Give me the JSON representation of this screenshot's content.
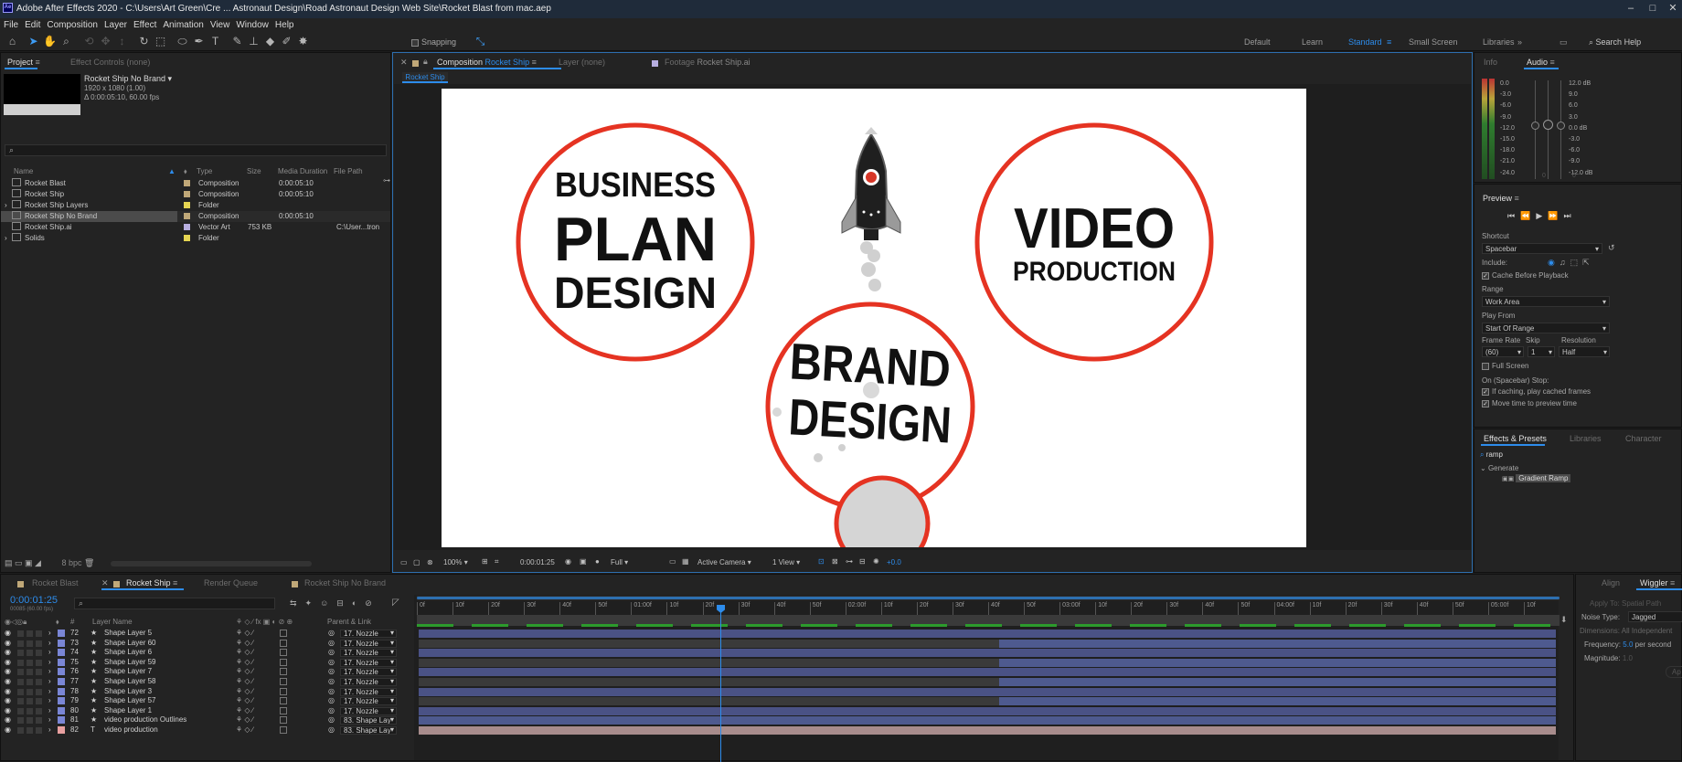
{
  "app": {
    "title": "Adobe After Effects 2020 - C:\\Users\\Art Green\\Cre ... Astronaut Design\\Road Astronaut Design Web Site\\Rocket Blast from mac.aep",
    "logo": "Ae"
  },
  "menu": [
    "File",
    "Edit",
    "Composition",
    "Layer",
    "Effect",
    "Animation",
    "View",
    "Window",
    "Help"
  ],
  "toolbar": {
    "snapping": "Snapping",
    "workspaces": [
      "Default",
      "Learn",
      "Standard",
      "Small Screen",
      "Libraries"
    ],
    "active_workspace": "Standard",
    "search": "Search Help"
  },
  "project": {
    "tab": "Project",
    "effect_controls": "Effect Controls (none)",
    "item_name": "Rocket Ship No Brand ▾",
    "item_dims": "1920 x 1080 (1.00)",
    "item_dur": "Δ 0:00:05:10, 60.00 fps",
    "columns": [
      "Name",
      "Type",
      "Size",
      "Media Duration",
      "File Path"
    ],
    "items": [
      {
        "name": "Rocket Blast",
        "type": "Composition",
        "size": "",
        "dur": "0:00:05:10",
        "path": "",
        "color": "#c0a878"
      },
      {
        "name": "Rocket Ship",
        "type": "Composition",
        "size": "",
        "dur": "0:00:05:10",
        "path": "",
        "color": "#c0a878"
      },
      {
        "name": "Rocket Ship Layers",
        "type": "Folder",
        "size": "",
        "dur": "",
        "path": "",
        "color": "#e6d552"
      },
      {
        "name": "Rocket Ship No Brand",
        "type": "Composition",
        "size": "",
        "dur": "0:00:05:10",
        "path": "",
        "color": "#c0a878"
      },
      {
        "name": "Rocket Ship.ai",
        "type": "Vector Art",
        "size": "753 KB",
        "dur": "",
        "path": "C:\\User...tron",
        "color": "#b7aee0"
      },
      {
        "name": "Solids",
        "type": "Folder",
        "size": "",
        "dur": "",
        "path": "",
        "color": "#e6d552"
      }
    ],
    "bpc": "8 bpc"
  },
  "viewer": {
    "tab_comp": "Composition",
    "comp_name": "Rocket Ship",
    "layer_tab": "Layer (none)",
    "footage_tab": "Footage",
    "footage_name": "Rocket Ship.ai",
    "breadcrumb": "Rocket Ship",
    "zoom": "100%",
    "timecode": "0:00:01:25",
    "resolution": "Full",
    "camera": "Active Camera",
    "views": "1 View",
    "exposure": "+0.0"
  },
  "artwork": {
    "circle1": [
      "BUSINESS",
      "PLAN",
      "DESIGN"
    ],
    "circle2": [
      "VIDEO",
      "PRODUCTION"
    ],
    "circle3": [
      "BRAND",
      "DESIGN"
    ],
    "ring_color": "#e53322"
  },
  "info": {
    "tab_info": "Info",
    "tab_audio": "Audio",
    "left_scale": [
      "0.0",
      "-3.0",
      "-6.0",
      "-9.0",
      "-12.0",
      "-15.0",
      "-18.0",
      "-21.0",
      "-24.0"
    ],
    "right_scale": [
      "12.0 dB",
      "9.0",
      "6.0",
      "3.0",
      "0.0 dB",
      "-3.0",
      "-6.0",
      "-9.0",
      "-12.0 dB"
    ],
    "meter_zero": [
      "0",
      "0"
    ]
  },
  "preview": {
    "title": "Preview",
    "shortcut_label": "Shortcut",
    "shortcut": "Spacebar",
    "include": "Include:",
    "cache": "Cache Before Playback",
    "range_label": "Range",
    "range": "Work Area",
    "play_from_label": "Play From",
    "play_from": "Start Of Range",
    "frame_rate_label": "Frame Rate",
    "skip_label": "Skip",
    "res_label": "Resolution",
    "frame_rate": "(60)",
    "skip": "1",
    "res": "Half",
    "full_screen": "Full Screen",
    "stop_label": "On (Spacebar) Stop:",
    "if_caching": "If caching, play cached frames",
    "move_time": "Move time to preview time"
  },
  "effects": {
    "tab": "Effects & Presets",
    "libraries": "Libraries",
    "character": "Character",
    "search": "ramp",
    "group": "Generate",
    "item": "Gradient Ramp"
  },
  "timeline": {
    "tabs": [
      "Rocket Blast",
      "Rocket Ship",
      "Render Queue",
      "Rocket Ship No Brand"
    ],
    "active_tab": "Rocket Ship",
    "timecode": "0:00:01:25",
    "frames": "00085 (60.00 fps)",
    "col_layer": "Layer Name",
    "col_num": "#",
    "col_parent": "Parent & Link",
    "ruler": [
      "0f",
      "10f",
      "20f",
      "30f",
      "40f",
      "50f",
      "01:00f",
      "10f",
      "20f",
      "30f",
      "40f",
      "50f",
      "02:00f",
      "10f",
      "20f",
      "30f",
      "40f",
      "50f",
      "03:00f",
      "10f",
      "20f",
      "30f",
      "40f",
      "50f",
      "04:00f",
      "10f",
      "20f",
      "30f",
      "40f",
      "50f",
      "05:00f",
      "10f"
    ],
    "playhead_frames": 85,
    "total_frames": 320,
    "layers": [
      {
        "num": "72",
        "name": "Shape Layer 5",
        "parent": "17. Nozzle",
        "type": "star",
        "color": "#7a86d6",
        "split": 0
      },
      {
        "num": "73",
        "name": "Shape Layer 60",
        "parent": "17. Nozzle",
        "type": "star",
        "color": "#7a86d6",
        "split": 163
      },
      {
        "num": "74",
        "name": "Shape Layer 6",
        "parent": "17. Nozzle",
        "type": "star",
        "color": "#7a86d6",
        "split": 0
      },
      {
        "num": "75",
        "name": "Shape Layer 59",
        "parent": "17. Nozzle",
        "type": "star",
        "color": "#7a86d6",
        "split": 163
      },
      {
        "num": "76",
        "name": "Shape Layer 7",
        "parent": "17. Nozzle",
        "type": "star",
        "color": "#7a86d6",
        "split": 0
      },
      {
        "num": "77",
        "name": "Shape Layer 58",
        "parent": "17. Nozzle",
        "type": "star",
        "color": "#7a86d6",
        "split": 163
      },
      {
        "num": "78",
        "name": "Shape Layer 3",
        "parent": "17. Nozzle",
        "type": "star",
        "color": "#7a86d6",
        "split": 0
      },
      {
        "num": "79",
        "name": "Shape Layer 57",
        "parent": "17. Nozzle",
        "type": "star",
        "color": "#7a86d6",
        "split": 163
      },
      {
        "num": "80",
        "name": "Shape Layer 1",
        "parent": "17. Nozzle",
        "type": "star",
        "color": "#7a86d6",
        "split": 0
      },
      {
        "num": "81",
        "name": "video production Outlines",
        "parent": "83. Shape Lay",
        "type": "star",
        "color": "#7a86d6",
        "split": 0
      },
      {
        "num": "82",
        "name": "video production",
        "parent": "83. Shape Lay",
        "type": "text",
        "color": "#e8a0a0",
        "split": 0
      }
    ]
  },
  "wiggler": {
    "align": "Align",
    "tab": "Wiggler",
    "apply_to": "Apply To:",
    "apply_val": "Spatial Path",
    "noise_type": "Noise Type:",
    "noise_val": "Jagged",
    "dimensions": "Dimensions:",
    "dim_val": "All Independent",
    "frequency": "Frequency:",
    "freq_val": "5.0",
    "per_sec": "per second",
    "magnitude": "Magnitude:",
    "mag_val": "1.0",
    "apply_btn": "Ap"
  }
}
